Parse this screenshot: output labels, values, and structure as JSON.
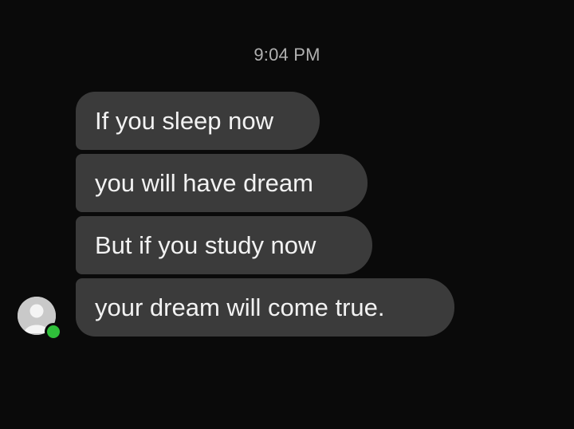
{
  "conversation": {
    "timestamp": "9:04 PM",
    "messages": [
      {
        "text": "If you sleep now"
      },
      {
        "text": "you will have dream"
      },
      {
        "text": "But if you study now"
      },
      {
        "text": "your dream will come true."
      }
    ],
    "sender": {
      "avatar_icon": "user-avatar-icon",
      "status": "online",
      "status_color": "#2fbf3a"
    }
  },
  "colors": {
    "background": "#0a0a0a",
    "bubble": "#3b3b3b",
    "text": "#f2f2f2",
    "timestamp": "#b0b0b0"
  }
}
